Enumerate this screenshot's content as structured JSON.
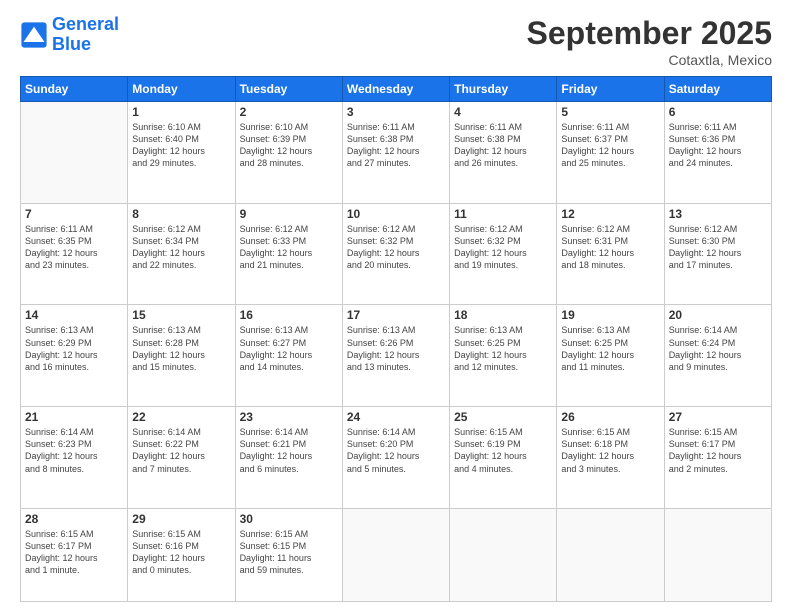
{
  "header": {
    "logo_line1": "General",
    "logo_line2": "Blue",
    "month": "September 2025",
    "location": "Cotaxtla, Mexico"
  },
  "days_of_week": [
    "Sunday",
    "Monday",
    "Tuesday",
    "Wednesday",
    "Thursday",
    "Friday",
    "Saturday"
  ],
  "weeks": [
    [
      {
        "day": "",
        "info": ""
      },
      {
        "day": "1",
        "info": "Sunrise: 6:10 AM\nSunset: 6:40 PM\nDaylight: 12 hours\nand 29 minutes."
      },
      {
        "day": "2",
        "info": "Sunrise: 6:10 AM\nSunset: 6:39 PM\nDaylight: 12 hours\nand 28 minutes."
      },
      {
        "day": "3",
        "info": "Sunrise: 6:11 AM\nSunset: 6:38 PM\nDaylight: 12 hours\nand 27 minutes."
      },
      {
        "day": "4",
        "info": "Sunrise: 6:11 AM\nSunset: 6:38 PM\nDaylight: 12 hours\nand 26 minutes."
      },
      {
        "day": "5",
        "info": "Sunrise: 6:11 AM\nSunset: 6:37 PM\nDaylight: 12 hours\nand 25 minutes."
      },
      {
        "day": "6",
        "info": "Sunrise: 6:11 AM\nSunset: 6:36 PM\nDaylight: 12 hours\nand 24 minutes."
      }
    ],
    [
      {
        "day": "7",
        "info": "Sunrise: 6:11 AM\nSunset: 6:35 PM\nDaylight: 12 hours\nand 23 minutes."
      },
      {
        "day": "8",
        "info": "Sunrise: 6:12 AM\nSunset: 6:34 PM\nDaylight: 12 hours\nand 22 minutes."
      },
      {
        "day": "9",
        "info": "Sunrise: 6:12 AM\nSunset: 6:33 PM\nDaylight: 12 hours\nand 21 minutes."
      },
      {
        "day": "10",
        "info": "Sunrise: 6:12 AM\nSunset: 6:32 PM\nDaylight: 12 hours\nand 20 minutes."
      },
      {
        "day": "11",
        "info": "Sunrise: 6:12 AM\nSunset: 6:32 PM\nDaylight: 12 hours\nand 19 minutes."
      },
      {
        "day": "12",
        "info": "Sunrise: 6:12 AM\nSunset: 6:31 PM\nDaylight: 12 hours\nand 18 minutes."
      },
      {
        "day": "13",
        "info": "Sunrise: 6:12 AM\nSunset: 6:30 PM\nDaylight: 12 hours\nand 17 minutes."
      }
    ],
    [
      {
        "day": "14",
        "info": "Sunrise: 6:13 AM\nSunset: 6:29 PM\nDaylight: 12 hours\nand 16 minutes."
      },
      {
        "day": "15",
        "info": "Sunrise: 6:13 AM\nSunset: 6:28 PM\nDaylight: 12 hours\nand 15 minutes."
      },
      {
        "day": "16",
        "info": "Sunrise: 6:13 AM\nSunset: 6:27 PM\nDaylight: 12 hours\nand 14 minutes."
      },
      {
        "day": "17",
        "info": "Sunrise: 6:13 AM\nSunset: 6:26 PM\nDaylight: 12 hours\nand 13 minutes."
      },
      {
        "day": "18",
        "info": "Sunrise: 6:13 AM\nSunset: 6:25 PM\nDaylight: 12 hours\nand 12 minutes."
      },
      {
        "day": "19",
        "info": "Sunrise: 6:13 AM\nSunset: 6:25 PM\nDaylight: 12 hours\nand 11 minutes."
      },
      {
        "day": "20",
        "info": "Sunrise: 6:14 AM\nSunset: 6:24 PM\nDaylight: 12 hours\nand 9 minutes."
      }
    ],
    [
      {
        "day": "21",
        "info": "Sunrise: 6:14 AM\nSunset: 6:23 PM\nDaylight: 12 hours\nand 8 minutes."
      },
      {
        "day": "22",
        "info": "Sunrise: 6:14 AM\nSunset: 6:22 PM\nDaylight: 12 hours\nand 7 minutes."
      },
      {
        "day": "23",
        "info": "Sunrise: 6:14 AM\nSunset: 6:21 PM\nDaylight: 12 hours\nand 6 minutes."
      },
      {
        "day": "24",
        "info": "Sunrise: 6:14 AM\nSunset: 6:20 PM\nDaylight: 12 hours\nand 5 minutes."
      },
      {
        "day": "25",
        "info": "Sunrise: 6:15 AM\nSunset: 6:19 PM\nDaylight: 12 hours\nand 4 minutes."
      },
      {
        "day": "26",
        "info": "Sunrise: 6:15 AM\nSunset: 6:18 PM\nDaylight: 12 hours\nand 3 minutes."
      },
      {
        "day": "27",
        "info": "Sunrise: 6:15 AM\nSunset: 6:17 PM\nDaylight: 12 hours\nand 2 minutes."
      }
    ],
    [
      {
        "day": "28",
        "info": "Sunrise: 6:15 AM\nSunset: 6:17 PM\nDaylight: 12 hours\nand 1 minute."
      },
      {
        "day": "29",
        "info": "Sunrise: 6:15 AM\nSunset: 6:16 PM\nDaylight: 12 hours\nand 0 minutes."
      },
      {
        "day": "30",
        "info": "Sunrise: 6:15 AM\nSunset: 6:15 PM\nDaylight: 11 hours\nand 59 minutes."
      },
      {
        "day": "",
        "info": ""
      },
      {
        "day": "",
        "info": ""
      },
      {
        "day": "",
        "info": ""
      },
      {
        "day": "",
        "info": ""
      }
    ]
  ]
}
